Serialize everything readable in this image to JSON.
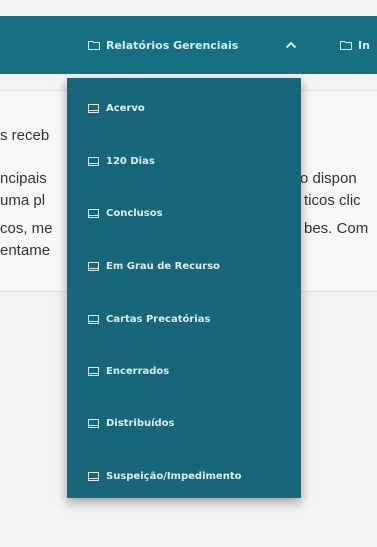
{
  "navbar": {
    "relatorios_label": "Relatórios Gerenciais",
    "next_label": "In"
  },
  "content": {
    "lines": [
      "s receb",
      "ncipais",
      "o dispon",
      "uma pl",
      "ticos clic",
      "cos, me",
      "bes. Com",
      "entame"
    ]
  },
  "dropdown": {
    "items": [
      {
        "label": "Acervo"
      },
      {
        "label": "120 Dias"
      },
      {
        "label": "Conclusos"
      },
      {
        "label": "Em Grau de Recurso"
      },
      {
        "label": "Cartas Precatórias"
      },
      {
        "label": "Encerrados"
      },
      {
        "label": "Distribuídos"
      },
      {
        "label": "Suspeição/Impedimento"
      }
    ]
  },
  "colors": {
    "navbar": "#176f82",
    "dropdown": "#17667a",
    "text_light": "#dceff4"
  }
}
